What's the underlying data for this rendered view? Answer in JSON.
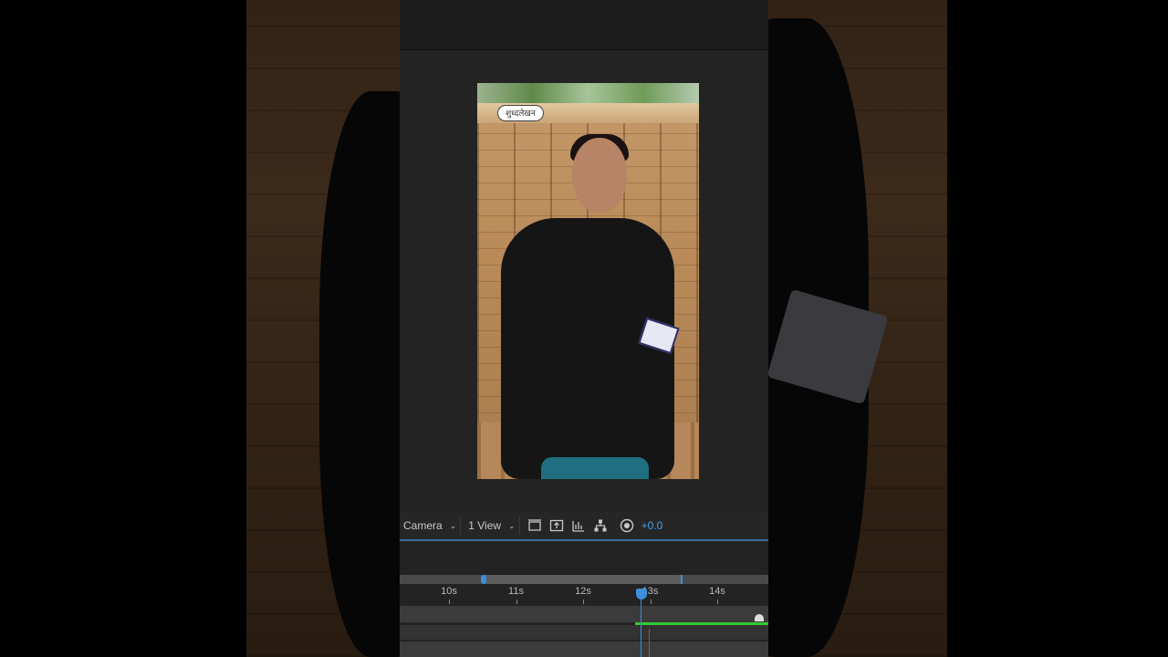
{
  "comp_viewer": {
    "logo_text": "शुध्दलेखन"
  },
  "toolbar": {
    "camera_label": "Camera",
    "view_label": "1 View",
    "exposure_value": "+0.0",
    "icons": [
      "region-of-interest-icon",
      "snapshot-icon",
      "show-channel-icon",
      "flowchart-icon",
      "reset-exposure-icon"
    ]
  },
  "timeline": {
    "ticks": [
      {
        "label": "10s",
        "seconds": 10
      },
      {
        "label": "11s",
        "seconds": 11
      },
      {
        "label": "12s",
        "seconds": 12
      },
      {
        "label": "13s",
        "seconds": 13
      },
      {
        "label": "14s",
        "seconds": 14
      }
    ],
    "current_time_seconds": 12.85,
    "colors": {
      "playhead": "#3c8fd8",
      "layer_bar": "#2ecc2e",
      "end_marker": "#d83c3c"
    }
  }
}
